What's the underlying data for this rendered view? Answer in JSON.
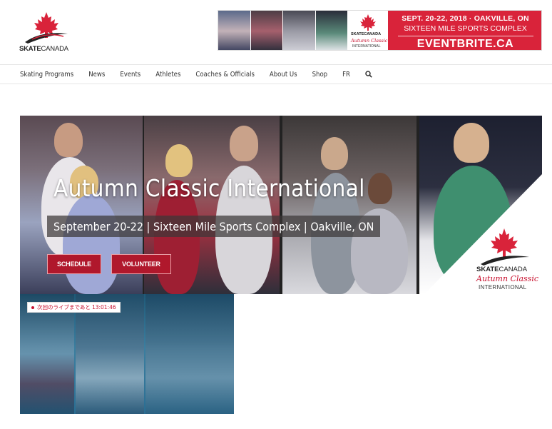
{
  "header": {
    "logo_brand_bold": "SKATE",
    "logo_brand_thin": "CANADA"
  },
  "banner": {
    "brand": "SKATECANADA",
    "script": "Autumn Classic",
    "sub": "INTERNATIONAL",
    "line1": "SEPT. 20-22, 2018 · OAKVILLE, ON",
    "line2": "SIXTEEN MILE SPORTS COMPLEX",
    "line3": "EVENTBRITE.CA"
  },
  "nav": {
    "items": [
      {
        "label": "Skating Programs"
      },
      {
        "label": "News"
      },
      {
        "label": "Events"
      },
      {
        "label": "Athletes"
      },
      {
        "label": "Coaches & Officials"
      },
      {
        "label": "About Us"
      },
      {
        "label": "Shop"
      },
      {
        "label": "FR"
      }
    ],
    "search_icon": "search-icon"
  },
  "hero": {
    "title": "Autumn Classic International",
    "subtitle": "September 20-22 | Sixteen Mile Sports Complex | Oakville, ON",
    "schedule_label": "SCHEDULE",
    "volunteer_label": "VOLUNTEER",
    "brand_bold": "SKATE",
    "brand_thin": "CANADA",
    "script": "Autumn Classic",
    "intl": "INTERNATIONAL"
  },
  "video": {
    "live_text": "次回のライブまであと",
    "countdown": "13:01:46"
  },
  "colors": {
    "brand_red": "#d9233a",
    "button_red": "#b0182c"
  }
}
